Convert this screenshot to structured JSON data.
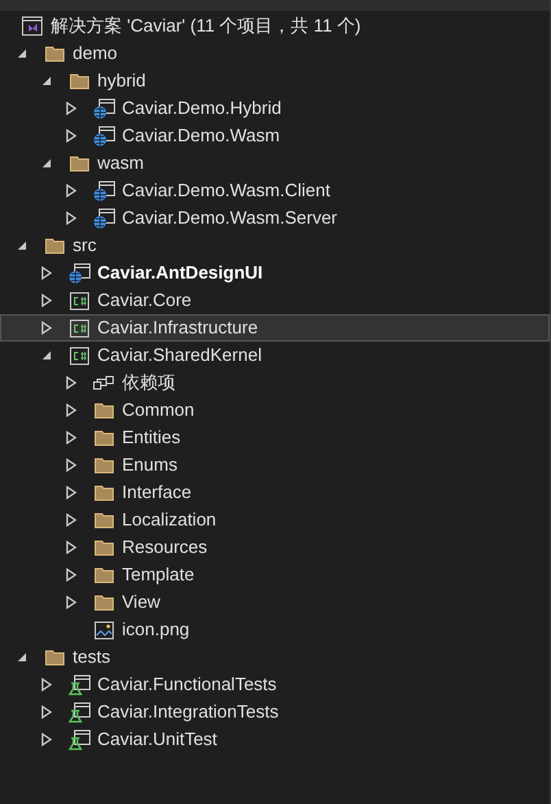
{
  "solution": {
    "label": "解决方案 'Caviar' (11 个项目，共 11 个)"
  },
  "tree": [
    {
      "label": "demo",
      "kind": "folder",
      "expandable": true,
      "expanded": true,
      "selected": false,
      "bold": false,
      "children": [
        {
          "label": "hybrid",
          "kind": "folder",
          "expandable": true,
          "expanded": true,
          "selected": false,
          "bold": false,
          "children": [
            {
              "label": "Caviar.Demo.Hybrid",
              "kind": "web",
              "expandable": true,
              "expanded": false,
              "selected": false,
              "bold": false
            },
            {
              "label": "Caviar.Demo.Wasm",
              "kind": "web",
              "expandable": true,
              "expanded": false,
              "selected": false,
              "bold": false
            }
          ]
        },
        {
          "label": "wasm",
          "kind": "folder",
          "expandable": true,
          "expanded": true,
          "selected": false,
          "bold": false,
          "children": [
            {
              "label": "Caviar.Demo.Wasm.Client",
              "kind": "web",
              "expandable": true,
              "expanded": false,
              "selected": false,
              "bold": false
            },
            {
              "label": "Caviar.Demo.Wasm.Server",
              "kind": "web",
              "expandable": true,
              "expanded": false,
              "selected": false,
              "bold": false
            }
          ]
        }
      ]
    },
    {
      "label": "src",
      "kind": "folder",
      "expandable": true,
      "expanded": true,
      "selected": false,
      "bold": false,
      "children": [
        {
          "label": "Caviar.AntDesignUI",
          "kind": "web",
          "expandable": true,
          "expanded": false,
          "selected": false,
          "bold": true
        },
        {
          "label": "Caviar.Core",
          "kind": "csharp",
          "expandable": true,
          "expanded": false,
          "selected": false,
          "bold": false
        },
        {
          "label": "Caviar.Infrastructure",
          "kind": "csharp",
          "expandable": true,
          "expanded": false,
          "selected": true,
          "bold": false
        },
        {
          "label": "Caviar.SharedKernel",
          "kind": "csharp",
          "expandable": true,
          "expanded": true,
          "selected": false,
          "bold": false,
          "children": [
            {
              "label": "依赖项",
              "kind": "deps",
              "expandable": true,
              "expanded": false,
              "selected": false,
              "bold": false
            },
            {
              "label": "Common",
              "kind": "folder",
              "expandable": true,
              "expanded": false,
              "selected": false,
              "bold": false
            },
            {
              "label": "Entities",
              "kind": "folder",
              "expandable": true,
              "expanded": false,
              "selected": false,
              "bold": false
            },
            {
              "label": "Enums",
              "kind": "folder",
              "expandable": true,
              "expanded": false,
              "selected": false,
              "bold": false
            },
            {
              "label": "Interface",
              "kind": "folder",
              "expandable": true,
              "expanded": false,
              "selected": false,
              "bold": false
            },
            {
              "label": "Localization",
              "kind": "folder",
              "expandable": true,
              "expanded": false,
              "selected": false,
              "bold": false
            },
            {
              "label": "Resources",
              "kind": "folder",
              "expandable": true,
              "expanded": false,
              "selected": false,
              "bold": false
            },
            {
              "label": "Template",
              "kind": "folder",
              "expandable": true,
              "expanded": false,
              "selected": false,
              "bold": false
            },
            {
              "label": "View",
              "kind": "folder",
              "expandable": true,
              "expanded": false,
              "selected": false,
              "bold": false
            },
            {
              "label": "icon.png",
              "kind": "image",
              "expandable": false,
              "selected": false,
              "bold": false
            }
          ]
        }
      ]
    },
    {
      "label": "tests",
      "kind": "folder",
      "expandable": true,
      "expanded": true,
      "selected": false,
      "bold": false,
      "children": [
        {
          "label": "Caviar.FunctionalTests",
          "kind": "test",
          "expandable": true,
          "expanded": false,
          "selected": false,
          "bold": false
        },
        {
          "label": "Caviar.IntegrationTests",
          "kind": "test",
          "expandable": true,
          "expanded": false,
          "selected": false,
          "bold": false
        },
        {
          "label": "Caviar.UnitTest",
          "kind": "test",
          "expandable": true,
          "expanded": false,
          "selected": false,
          "bold": false
        }
      ]
    }
  ]
}
